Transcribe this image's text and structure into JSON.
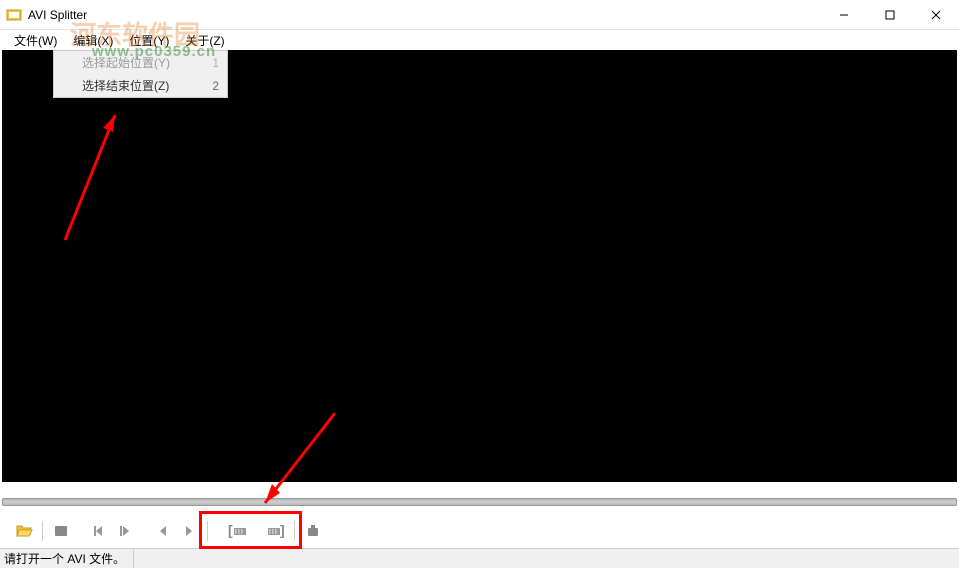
{
  "titlebar": {
    "title": "AVI Splitter"
  },
  "menubar": {
    "items": [
      {
        "label": "文件(W)"
      },
      {
        "label": "编辑(X)"
      },
      {
        "label": "位置(Y)"
      },
      {
        "label": "关于(Z)"
      }
    ]
  },
  "dropdown": {
    "items": [
      {
        "label": "选择起始位置(Y)",
        "shortcut": "1"
      },
      {
        "label": "选择结束位置(Z)",
        "shortcut": "2"
      }
    ]
  },
  "watermark": {
    "text1": "河东软件园",
    "text2": "www.pc0359.cn"
  },
  "toolbar": {
    "icons": {
      "open": "folder-open-icon",
      "folder": "folder-icon",
      "prev_frame": "prev-frame-icon",
      "next_frame": "next-frame-icon",
      "prev": "prev-icon",
      "next": "next-icon",
      "mark_in": "mark-in-icon",
      "mark_out": "mark-out-icon",
      "export": "export-icon"
    }
  },
  "statusbar": {
    "text": "请打开一个 AVI 文件。"
  }
}
